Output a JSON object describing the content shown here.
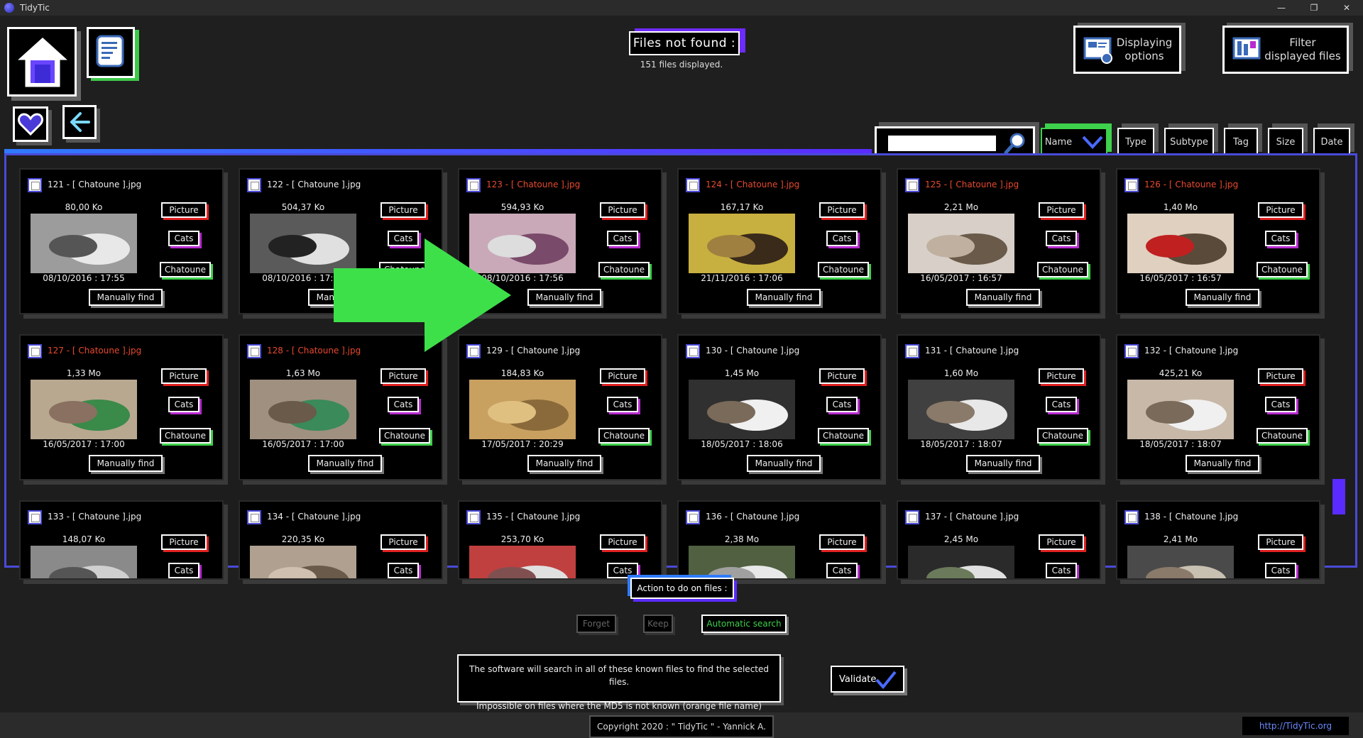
{
  "window": {
    "title": "TidyTic",
    "minimize": "—",
    "restore": "❐",
    "close": "✕"
  },
  "header": {
    "title": "Files not found :",
    "subtitle": "151 files displayed.",
    "display_options": "Displaying options",
    "filter_files": "Filter displayed files"
  },
  "sort": {
    "search_placeholder": "",
    "buttons": [
      {
        "label": "Name",
        "active": true
      },
      {
        "label": "Type"
      },
      {
        "label": "Subtype"
      },
      {
        "label": "Tag"
      },
      {
        "label": "Size"
      },
      {
        "label": "Date"
      }
    ]
  },
  "cards": [
    {
      "name": "121 - [ Chatoune ].jpg",
      "orange": false,
      "size": "80,00 Ko",
      "date": "08/10/2016 : 17:55",
      "type": "Picture",
      "sub": "Cats",
      "tag": "Chatoune",
      "action": "Manually find"
    },
    {
      "name": "122 - [ Chatoune ].jpg",
      "orange": false,
      "size": "504,37 Ko",
      "date": "08/10/2016 : 17:56",
      "type": "Picture",
      "sub": "Cats",
      "tag": "Chatoune",
      "action": "Manually find"
    },
    {
      "name": "123 - [ Chatoune ].jpg",
      "orange": true,
      "size": "594,93 Ko",
      "date": "08/10/2016 : 17:56",
      "type": "Picture",
      "sub": "Cats",
      "tag": "Chatoune",
      "action": "Manually find"
    },
    {
      "name": "124 - [ Chatoune ].jpg",
      "orange": true,
      "size": "167,17 Ko",
      "date": "21/11/2016 : 17:06",
      "type": "Picture",
      "sub": "Cats",
      "tag": "Chatoune",
      "action": "Manually find"
    },
    {
      "name": "125 - [ Chatoune ].jpg",
      "orange": true,
      "size": "2,21 Mo",
      "date": "16/05/2017 : 16:57",
      "type": "Picture",
      "sub": "Cats",
      "tag": "Chatoune",
      "action": "Manually find"
    },
    {
      "name": "126 - [ Chatoune ].jpg",
      "orange": true,
      "size": "1,40 Mo",
      "date": "16/05/2017 : 16:57",
      "type": "Picture",
      "sub": "Cats",
      "tag": "Chatoune",
      "action": "Manually find"
    },
    {
      "name": "127 - [ Chatoune ].jpg",
      "orange": true,
      "size": "1,33 Mo",
      "date": "16/05/2017 : 17:00",
      "type": "Picture",
      "sub": "Cats",
      "tag": "Chatoune",
      "action": "Manually find"
    },
    {
      "name": "128 - [ Chatoune ].jpg",
      "orange": true,
      "size": "1,63 Mo",
      "date": "16/05/2017 : 17:00",
      "type": "Picture",
      "sub": "Cats",
      "tag": "Chatoune",
      "action": "Manually find"
    },
    {
      "name": "129 - [ Chatoune ].jpg",
      "orange": false,
      "size": "184,83 Ko",
      "date": "17/05/2017 : 20:29",
      "type": "Picture",
      "sub": "Cats",
      "tag": "Chatoune",
      "action": "Manually find"
    },
    {
      "name": "130 - [ Chatoune ].jpg",
      "orange": false,
      "size": "1,45 Mo",
      "date": "18/05/2017 : 18:06",
      "type": "Picture",
      "sub": "Cats",
      "tag": "Chatoune",
      "action": "Manually find"
    },
    {
      "name": "131 - [ Chatoune ].jpg",
      "orange": false,
      "size": "1,60 Mo",
      "date": "18/05/2017 : 18:07",
      "type": "Picture",
      "sub": "Cats",
      "tag": "Chatoune",
      "action": "Manually find"
    },
    {
      "name": "132 - [ Chatoune ].jpg",
      "orange": false,
      "size": "425,21 Ko",
      "date": "18/05/2017 : 18:07",
      "type": "Picture",
      "sub": "Cats",
      "tag": "Chatoune",
      "action": "Manually find"
    },
    {
      "name": "133 - [ Chatoune ].jpg",
      "orange": false,
      "size": "148,07 Ko",
      "date": "",
      "type": "Picture",
      "sub": "Cats",
      "tag": "",
      "action": ""
    },
    {
      "name": "134 - [ Chatoune ].jpg",
      "orange": false,
      "size": "220,35 Ko",
      "date": "",
      "type": "Picture",
      "sub": "Cats",
      "tag": "",
      "action": ""
    },
    {
      "name": "135 - [ Chatoune ].jpg",
      "orange": false,
      "size": "253,70 Ko",
      "date": "",
      "type": "Picture",
      "sub": "Cats",
      "tag": "",
      "action": ""
    },
    {
      "name": "136 - [ Chatoune ].jpg",
      "orange": false,
      "size": "2,38 Mo",
      "date": "",
      "type": "Picture",
      "sub": "Cats",
      "tag": "",
      "action": ""
    },
    {
      "name": "137 - [ Chatoune ].jpg",
      "orange": false,
      "size": "2,45 Mo",
      "date": "",
      "type": "Picture",
      "sub": "Cats",
      "tag": "",
      "action": ""
    },
    {
      "name": "138 - [ Chatoune ].jpg",
      "orange": false,
      "size": "2,41 Mo",
      "date": "",
      "type": "Picture",
      "sub": "Cats",
      "tag": "",
      "action": ""
    }
  ],
  "actions": {
    "label": "Action to do on files :",
    "forget": "Forget",
    "keep": "Keep",
    "auto": "Automatic search",
    "info_line1": "The software will search in all of these known files to find the selected files.",
    "info_line2": "Impossible on files where the MD5 is not known (orange file name)",
    "validate": "Validate"
  },
  "footer": {
    "copyright": "Copyright 2020 : \" TidyTic \" - Yannick A.",
    "url": "http://TidyTic.org"
  },
  "colors": {
    "accent_blue": "#4a4ad8",
    "accent_purple": "#5a2bff",
    "green": "#3ed14c",
    "red": "#e02020",
    "orange_text": "#e8492e"
  }
}
